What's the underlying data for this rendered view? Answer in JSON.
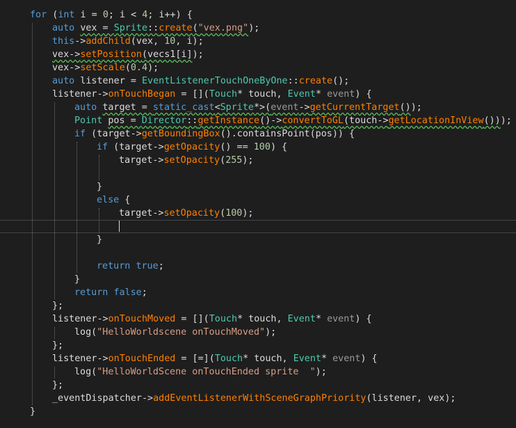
{
  "colors": {
    "background": "#1e1e1e",
    "keyword": "#569cd6",
    "type": "#4ec9b0",
    "function": "#ff8000",
    "method": "#ff8000",
    "string": "#d69d85",
    "number": "#b5cea8",
    "param": "#9a9a9a",
    "plain": "#dcdcdc"
  },
  "editor": {
    "lines": [
      {
        "indent": 1,
        "tokens": [
          {
            "t": "for",
            "c": "keyword"
          },
          {
            "t": " ("
          },
          {
            "t": "int",
            "c": "keyword"
          },
          {
            "t": " i = "
          },
          {
            "t": "0",
            "c": "number"
          },
          {
            "t": "; i < "
          },
          {
            "t": "4",
            "c": "number"
          },
          {
            "t": "; i++) {"
          }
        ]
      },
      {
        "indent": 2,
        "tokens": [
          {
            "t": "auto",
            "c": "keyword"
          },
          {
            "t": " "
          },
          {
            "t": "vex = ",
            "sq": true
          },
          {
            "t": "Sprite",
            "c": "type",
            "sq": true
          },
          {
            "t": "::",
            "sq": true
          },
          {
            "t": "create",
            "c": "function",
            "sq": true
          },
          {
            "t": "(",
            "sq": true
          },
          {
            "t": "\"vex.png\"",
            "c": "string",
            "sq": true
          },
          {
            "t": ");"
          }
        ]
      },
      {
        "indent": 2,
        "tokens": [
          {
            "t": "this",
            "c": "keyword"
          },
          {
            "t": "->"
          },
          {
            "t": "addChild",
            "c": "method"
          },
          {
            "t": "(vex, "
          },
          {
            "t": "10",
            "c": "number"
          },
          {
            "t": ", i);"
          }
        ]
      },
      {
        "indent": 2,
        "tokens": [
          {
            "t": "vex->",
            "sq": true
          },
          {
            "t": "setPosition",
            "c": "method",
            "sq": true
          },
          {
            "t": "(vecs1[i]",
            "sq": true
          },
          {
            "t": ");"
          }
        ]
      },
      {
        "indent": 2,
        "tokens": [
          {
            "t": "vex->"
          },
          {
            "t": "setScale",
            "c": "method"
          },
          {
            "t": "("
          },
          {
            "t": "0.4",
            "c": "number"
          },
          {
            "t": ");"
          }
        ]
      },
      {
        "indent": 2,
        "tokens": [
          {
            "t": "auto",
            "c": "keyword"
          },
          {
            "t": " listener = "
          },
          {
            "t": "EventListenerTouchOneByOne",
            "c": "type"
          },
          {
            "t": "::"
          },
          {
            "t": "create",
            "c": "function"
          },
          {
            "t": "();"
          }
        ]
      },
      {
        "indent": 2,
        "tokens": [
          {
            "t": "listener->"
          },
          {
            "t": "onTouchBegan",
            "c": "method"
          },
          {
            "t": " = [](",
            "c": "plain"
          },
          {
            "t": "Touch",
            "c": "type"
          },
          {
            "t": "* touch, "
          },
          {
            "t": "Event",
            "c": "type"
          },
          {
            "t": "* "
          },
          {
            "t": "event",
            "c": "param"
          },
          {
            "t": ") {"
          }
        ]
      },
      {
        "indent": 3,
        "tokens": [
          {
            "t": "auto",
            "c": "keyword"
          },
          {
            "t": " "
          },
          {
            "t": "target = ",
            "sq": true
          },
          {
            "t": "static_cast",
            "c": "keyword",
            "sq": true
          },
          {
            "t": "<",
            "sq": true
          },
          {
            "t": "Sprite",
            "c": "type",
            "sq": true
          },
          {
            "t": "*>(",
            "sq": true
          },
          {
            "t": "event",
            "c": "param",
            "sq": true
          },
          {
            "t": "->",
            "sq": true
          },
          {
            "t": "getCurrentTarget",
            "c": "method",
            "sq": true
          },
          {
            "t": "()",
            "sq": true
          },
          {
            "t": ");"
          }
        ]
      },
      {
        "indent": 3,
        "tokens": [
          {
            "t": "Point",
            "c": "type"
          },
          {
            "t": " "
          },
          {
            "t": "pos = ",
            "sq": true
          },
          {
            "t": "Director",
            "c": "type",
            "sq": true
          },
          {
            "t": "::",
            "sq": true
          },
          {
            "t": "getInstance",
            "c": "function",
            "sq": true
          },
          {
            "t": "()->",
            "sq": true
          },
          {
            "t": "convertToGL",
            "c": "method",
            "sq": true
          },
          {
            "t": "(touch->",
            "sq": true
          },
          {
            "t": "getLocationInView",
            "c": "method",
            "sq": true
          },
          {
            "t": "())",
            "sq": true
          },
          {
            "t": ");"
          }
        ]
      },
      {
        "indent": 3,
        "tokens": [
          {
            "t": "if",
            "c": "keyword"
          },
          {
            "t": " (target->"
          },
          {
            "t": "getBoundingBox",
            "c": "method"
          },
          {
            "t": "().containsPoint(pos)) {"
          }
        ]
      },
      {
        "indent": 4,
        "tokens": [
          {
            "t": "if",
            "c": "keyword"
          },
          {
            "t": " (target->"
          },
          {
            "t": "getOpacity",
            "c": "method"
          },
          {
            "t": "() == "
          },
          {
            "t": "100",
            "c": "number"
          },
          {
            "t": ") {"
          }
        ]
      },
      {
        "indent": 5,
        "tokens": [
          {
            "t": "target->"
          },
          {
            "t": "setOpacity",
            "c": "method"
          },
          {
            "t": "("
          },
          {
            "t": "255",
            "c": "number"
          },
          {
            "t": ");"
          }
        ]
      },
      {
        "indent": 5,
        "tokens": []
      },
      {
        "indent": 4,
        "tokens": [
          {
            "t": "}"
          }
        ]
      },
      {
        "indent": 4,
        "tokens": [
          {
            "t": "else",
            "c": "keyword"
          },
          {
            "t": " {"
          }
        ]
      },
      {
        "indent": 5,
        "tokens": [
          {
            "t": "target->"
          },
          {
            "t": "setOpacity",
            "c": "method"
          },
          {
            "t": "("
          },
          {
            "t": "100",
            "c": "number"
          },
          {
            "t": ");"
          }
        ]
      },
      {
        "indent": 5,
        "tokens": [],
        "current": true
      },
      {
        "indent": 4,
        "tokens": [
          {
            "t": "}"
          }
        ]
      },
      {
        "indent": 4,
        "tokens": []
      },
      {
        "indent": 4,
        "tokens": [
          {
            "t": "return",
            "c": "keyword"
          },
          {
            "t": " "
          },
          {
            "t": "true",
            "c": "keyword"
          },
          {
            "t": ";"
          }
        ]
      },
      {
        "indent": 3,
        "tokens": [
          {
            "t": "}"
          }
        ]
      },
      {
        "indent": 3,
        "tokens": [
          {
            "t": "return",
            "c": "keyword"
          },
          {
            "t": " "
          },
          {
            "t": "false",
            "c": "keyword"
          },
          {
            "t": ";"
          }
        ]
      },
      {
        "indent": 2,
        "tokens": [
          {
            "t": "};"
          }
        ]
      },
      {
        "indent": 2,
        "tokens": [
          {
            "t": "listener->"
          },
          {
            "t": "onTouchMoved",
            "c": "method"
          },
          {
            "t": " = [](",
            "c": "plain"
          },
          {
            "t": "Touch",
            "c": "type"
          },
          {
            "t": "* touch, "
          },
          {
            "t": "Event",
            "c": "type"
          },
          {
            "t": "* "
          },
          {
            "t": "event",
            "c": "param"
          },
          {
            "t": ") {"
          }
        ]
      },
      {
        "indent": 3,
        "tokens": [
          {
            "t": "log("
          },
          {
            "t": "\"HelloWorldscene onTouchMoved\"",
            "c": "string"
          },
          {
            "t": ");"
          }
        ]
      },
      {
        "indent": 2,
        "tokens": [
          {
            "t": "};"
          }
        ]
      },
      {
        "indent": 2,
        "tokens": [
          {
            "t": "listener->"
          },
          {
            "t": "onTouchEnded",
            "c": "method"
          },
          {
            "t": " = [=](",
            "c": "plain"
          },
          {
            "t": "Touch",
            "c": "type"
          },
          {
            "t": "* touch, "
          },
          {
            "t": "Event",
            "c": "type"
          },
          {
            "t": "* "
          },
          {
            "t": "event",
            "c": "param"
          },
          {
            "t": ") {"
          }
        ]
      },
      {
        "indent": 3,
        "tokens": [
          {
            "t": "log("
          },
          {
            "t": "\"HelloWorldScene onTouchEnded sprite  \"",
            "c": "string"
          },
          {
            "t": ");"
          }
        ]
      },
      {
        "indent": 2,
        "tokens": [
          {
            "t": "};"
          }
        ]
      },
      {
        "indent": 2,
        "tokens": [
          {
            "t": "_eventDispatcher->"
          },
          {
            "t": "addEventListenerWithSceneGraphPriority",
            "c": "method"
          },
          {
            "t": "(listener, vex);"
          }
        ]
      },
      {
        "indent": 1,
        "tokens": [
          {
            "t": "}"
          }
        ]
      }
    ]
  }
}
